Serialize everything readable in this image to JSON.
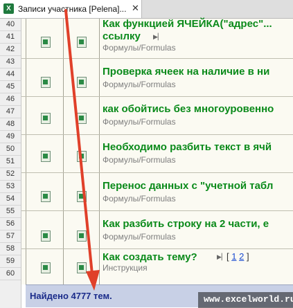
{
  "tab": {
    "title": "Записи участника [Pelena]...",
    "close": "✕",
    "icon": "excel-icon"
  },
  "row_numbers": [
    "40",
    "41",
    "42",
    "43",
    "44",
    "45",
    "46",
    "47",
    "48",
    "49",
    "50",
    "51",
    "52",
    "53",
    "54",
    "55",
    "56",
    "57",
    "58",
    "59",
    "60"
  ],
  "posts": [
    {
      "title": "Как функцией ЯЧЕЙКА(\"адрес\"...",
      "title2": "ссылку",
      "category": "Формулы/Formulas"
    },
    {
      "title": "Проверка ячеек на наличие в ни",
      "category": "Формулы/Formulas"
    },
    {
      "title": "как обойтись без многоуровенно",
      "category": "Формулы/Formulas"
    },
    {
      "title": "Необходимо разбить текст в ячй",
      "category": "Формулы/Formulas"
    },
    {
      "title": "Перенос данных с \"учетной табл",
      "category": "Формулы/Formulas"
    },
    {
      "title": "Как разбить строку на 2 части, е",
      "category": "Формулы/Formulas"
    },
    {
      "title": "Как создать тему?",
      "category": "Инструкция",
      "pages_open": "[",
      "page1": "1",
      "page2": "2",
      "pages_close": "]"
    }
  ],
  "footer": {
    "found": "Найдено 4777 тем."
  },
  "watermark": {
    "text": "www.excelworld.ru"
  },
  "colors": {
    "title_green": "#0a8a1a",
    "footer_bg": "#c8d0e6",
    "arrow_red": "#e0402a"
  }
}
